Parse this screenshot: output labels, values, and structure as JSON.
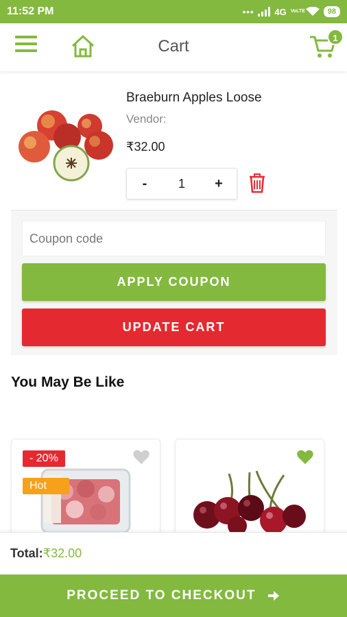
{
  "status_bar": {
    "time": "11:52 PM",
    "network": "4G",
    "volte": "VoLTE",
    "battery": "98"
  },
  "header": {
    "title": "Cart",
    "cart_count": "1"
  },
  "cart_item": {
    "name": "Braeburn Apples Loose",
    "vendor_label": "Vendor:",
    "price": "₹32.00",
    "quantity": "1",
    "minus": "-",
    "plus": "+"
  },
  "coupon": {
    "placeholder": "Coupon code",
    "apply_label": "APPLY COUPON",
    "update_label": "UPDATE CART"
  },
  "suggestions": {
    "title": "You May Be Like",
    "cards": [
      {
        "badge_sale": "- 20%",
        "badge_hot": "Hot",
        "favorite": false,
        "image": "diced-meat-tray"
      },
      {
        "favorite": true,
        "image": "cherries"
      }
    ]
  },
  "footer": {
    "total_label": "Total:",
    "total_value": "₹32.00",
    "checkout_label": "PROCEED TO CHECKOUT"
  },
  "colors": {
    "brand_green": "#83b93f",
    "danger_red": "#e42a30",
    "hot_orange": "#f7a11a"
  }
}
